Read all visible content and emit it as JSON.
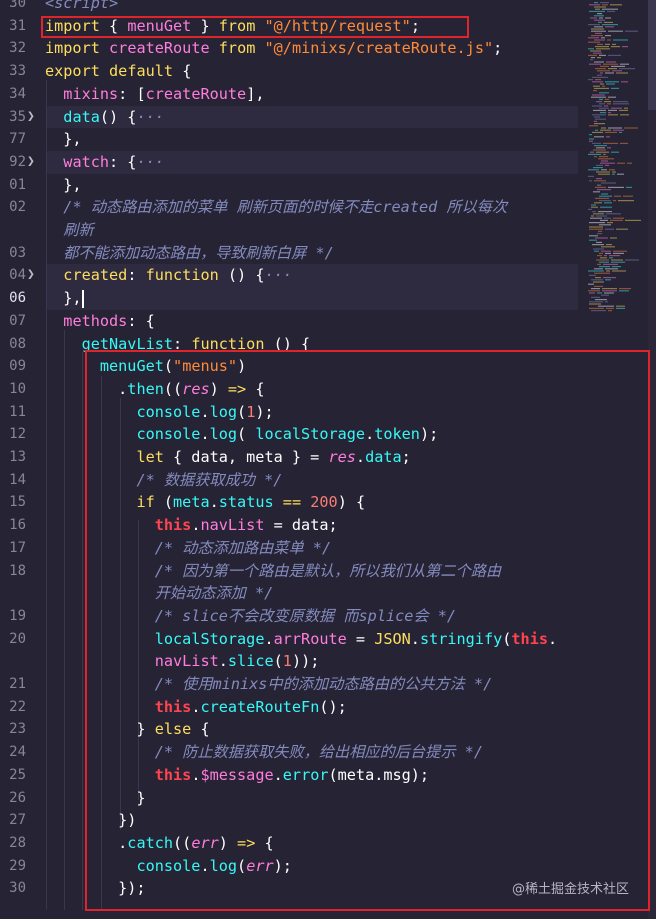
{
  "editor": {
    "line_numbers": [
      "30",
      "31",
      "32",
      "33",
      "34",
      "35",
      "77",
      "92",
      "01",
      "02",
      "",
      "03",
      "04",
      "06",
      "07",
      "08",
      "09",
      "10",
      "11",
      "12",
      "13",
      "14",
      "15",
      "16",
      "17",
      "18",
      "",
      "19",
      "20",
      "",
      "21",
      "22",
      "23",
      "24",
      "25",
      "26",
      "27",
      "28",
      "29",
      "30"
    ],
    "lines": [
      [
        [
          "cm",
          "<script>"
        ]
      ],
      [
        [
          "kw",
          "import"
        ],
        [
          "pl",
          " { "
        ],
        [
          "id",
          "menuGet"
        ],
        [
          "pl",
          " } "
        ],
        [
          "kw",
          "from"
        ],
        [
          "pl",
          " "
        ],
        [
          "str",
          "\"@/http/request\""
        ],
        [
          "pl",
          ";"
        ]
      ],
      [
        [
          "kw",
          "import"
        ],
        [
          "pl",
          " "
        ],
        [
          "id",
          "createRoute"
        ],
        [
          "pl",
          " "
        ],
        [
          "kw",
          "from"
        ],
        [
          "pl",
          " "
        ],
        [
          "str",
          "\"@/minixs/createRoute.js\""
        ],
        [
          "pl",
          ";"
        ]
      ],
      [
        [
          "kw",
          "export"
        ],
        [
          "pl",
          " "
        ],
        [
          "kw",
          "default"
        ],
        [
          "pl",
          " {"
        ]
      ],
      [
        [
          "pl",
          "  "
        ],
        [
          "prop",
          "mixins"
        ],
        [
          "pl",
          ": ["
        ],
        [
          "id",
          "createRoute"
        ],
        [
          "pl",
          "],"
        ]
      ],
      [
        [
          "pl",
          "  "
        ],
        [
          "fn",
          "data"
        ],
        [
          "pl",
          "() {"
        ],
        [
          "cm",
          "···"
        ]
      ],
      [
        [
          "pl",
          "  },"
        ]
      ],
      [
        [
          "pl",
          "  "
        ],
        [
          "prop",
          "watch"
        ],
        [
          "pl",
          ": {"
        ],
        [
          "cm",
          "···"
        ]
      ],
      [
        [
          "pl",
          "  },"
        ]
      ],
      [
        [
          "pl",
          "  "
        ],
        [
          "cm",
          "/* 动态路由添加的菜单 刷新页面的时候不走created 所以每次"
        ]
      ],
      [
        [
          "pl",
          "  "
        ],
        [
          "cm",
          "刷新"
        ]
      ],
      [
        [
          "pl",
          "  "
        ],
        [
          "cm",
          "都不能添加动态路由，导致刷新白屏 */"
        ]
      ],
      [
        [
          "pl",
          "  "
        ],
        [
          "kw",
          "created"
        ],
        [
          "pl",
          ": "
        ],
        [
          "kw",
          "function"
        ],
        [
          "pl",
          " () {"
        ],
        [
          "cm",
          "···"
        ]
      ],
      [
        [
          "pl",
          "  },"
        ]
      ],
      [
        [
          "pl",
          "  "
        ],
        [
          "prop",
          "methods"
        ],
        [
          "pl",
          ": {"
        ]
      ],
      [
        [
          "pl",
          "    "
        ],
        [
          "fn",
          "getNavList"
        ],
        [
          "pl",
          ": "
        ],
        [
          "kw",
          "function"
        ],
        [
          "pl",
          " () {"
        ]
      ],
      [
        [
          "pl",
          "      "
        ],
        [
          "fn",
          "menuGet"
        ],
        [
          "pl",
          "("
        ],
        [
          "str",
          "\"menus\""
        ],
        [
          "pl",
          ")"
        ]
      ],
      [
        [
          "pl",
          "        ."
        ],
        [
          "fn",
          "then"
        ],
        [
          "pl",
          "(("
        ],
        [
          "par",
          "res"
        ],
        [
          "pl",
          ") "
        ],
        [
          "op",
          "=>"
        ],
        [
          "pl",
          " {"
        ]
      ],
      [
        [
          "pl",
          "          "
        ],
        [
          "fn",
          "console"
        ],
        [
          "pl",
          "."
        ],
        [
          "fn",
          "log"
        ],
        [
          "pl",
          "("
        ],
        [
          "num",
          "1"
        ],
        [
          "pl",
          ");"
        ]
      ],
      [
        [
          "pl",
          "          "
        ],
        [
          "fn",
          "console"
        ],
        [
          "pl",
          "."
        ],
        [
          "fn",
          "log"
        ],
        [
          "pl",
          "( "
        ],
        [
          "fn",
          "localStorage"
        ],
        [
          "pl",
          "."
        ],
        [
          "fn",
          "token"
        ],
        [
          "pl",
          ");"
        ]
      ],
      [
        [
          "pl",
          "          "
        ],
        [
          "kw",
          "let"
        ],
        [
          "pl",
          " { data, meta } = "
        ],
        [
          "par",
          "res"
        ],
        [
          "pl",
          "."
        ],
        [
          "fn",
          "data"
        ],
        [
          "pl",
          ";"
        ]
      ],
      [
        [
          "pl",
          "          "
        ],
        [
          "cm",
          "/* 数据获取成功 */"
        ]
      ],
      [
        [
          "pl",
          "          "
        ],
        [
          "kw",
          "if"
        ],
        [
          "pl",
          " ("
        ],
        [
          "fn",
          "meta"
        ],
        [
          "pl",
          "."
        ],
        [
          "fn",
          "status"
        ],
        [
          "pl",
          " "
        ],
        [
          "op",
          "=="
        ],
        [
          "pl",
          " "
        ],
        [
          "num",
          "200"
        ],
        [
          "pl",
          ") {"
        ]
      ],
      [
        [
          "pl",
          "            "
        ],
        [
          "ths",
          "this"
        ],
        [
          "pl",
          "."
        ],
        [
          "prop",
          "navList"
        ],
        [
          "pl",
          " = data;"
        ]
      ],
      [
        [
          "pl",
          "            "
        ],
        [
          "cm",
          "/* 动态添加路由菜单 */"
        ]
      ],
      [
        [
          "pl",
          "            "
        ],
        [
          "cm",
          "/* 因为第一个路由是默认，所以我们从第二个路由"
        ]
      ],
      [
        [
          "pl",
          "            "
        ],
        [
          "cm",
          "开始动态添加 */"
        ]
      ],
      [
        [
          "pl",
          "            "
        ],
        [
          "cm",
          "/* slice不会改变原数据 而splice会 */"
        ]
      ],
      [
        [
          "pl",
          "            "
        ],
        [
          "fn",
          "localStorage"
        ],
        [
          "pl",
          "."
        ],
        [
          "prop",
          "arrRoute"
        ],
        [
          "pl",
          " = "
        ],
        [
          "kw",
          "JSON"
        ],
        [
          "pl",
          "."
        ],
        [
          "fn",
          "stringify"
        ],
        [
          "pl",
          "("
        ],
        [
          "ths",
          "this"
        ],
        [
          "pl",
          "."
        ]
      ],
      [
        [
          "pl",
          "            "
        ],
        [
          "prop",
          "navList"
        ],
        [
          "pl",
          "."
        ],
        [
          "fn",
          "slice"
        ],
        [
          "pl",
          "("
        ],
        [
          "num",
          "1"
        ],
        [
          "pl",
          "));"
        ]
      ],
      [
        [
          "pl",
          "            "
        ],
        [
          "cm",
          "/* 使用minixs中的添加动态路由的公共方法 */"
        ]
      ],
      [
        [
          "pl",
          "            "
        ],
        [
          "ths",
          "this"
        ],
        [
          "pl",
          "."
        ],
        [
          "fn",
          "createRouteFn"
        ],
        [
          "pl",
          "();"
        ]
      ],
      [
        [
          "pl",
          "          } "
        ],
        [
          "kw",
          "else"
        ],
        [
          "pl",
          " {"
        ]
      ],
      [
        [
          "pl",
          "            "
        ],
        [
          "cm",
          "/* 防止数据获取失败，给出相应的后台提示 */"
        ]
      ],
      [
        [
          "pl",
          "            "
        ],
        [
          "ths",
          "this"
        ],
        [
          "pl",
          "."
        ],
        [
          "id",
          "$message"
        ],
        [
          "pl",
          "."
        ],
        [
          "fn",
          "error"
        ],
        [
          "pl",
          "(meta.msg);"
        ]
      ],
      [
        [
          "pl",
          "          }"
        ]
      ],
      [
        [
          "pl",
          "        })"
        ]
      ],
      [
        [
          "pl",
          "        ."
        ],
        [
          "fn",
          "catch"
        ],
        [
          "pl",
          "(("
        ],
        [
          "par",
          "err"
        ],
        [
          "pl",
          ") "
        ],
        [
          "op",
          "=>"
        ],
        [
          "pl",
          " {"
        ]
      ],
      [
        [
          "pl",
          "          "
        ],
        [
          "fn",
          "console"
        ],
        [
          "pl",
          "."
        ],
        [
          "fn",
          "log"
        ],
        [
          "pl",
          "("
        ],
        [
          "par",
          "err"
        ],
        [
          "pl",
          ");"
        ]
      ],
      [
        [
          "pl",
          "        });"
        ]
      ]
    ],
    "folded_line_indices": [
      5,
      7,
      12
    ],
    "highlighted_line_indices": [
      5,
      7,
      12,
      13
    ],
    "active_line_index": 13
  },
  "watermark": "@稀土掘金技术社区",
  "colors": {
    "background": "#262335",
    "annotation_box": "#e0242c",
    "keyword": "#fede5d",
    "string": "#ff8b39",
    "function": "#36f9f6",
    "identifier": "#ff7edb",
    "comment": "#848bbd",
    "this": "#fe4450"
  },
  "icons": {
    "fold": "chevron-right-icon"
  }
}
